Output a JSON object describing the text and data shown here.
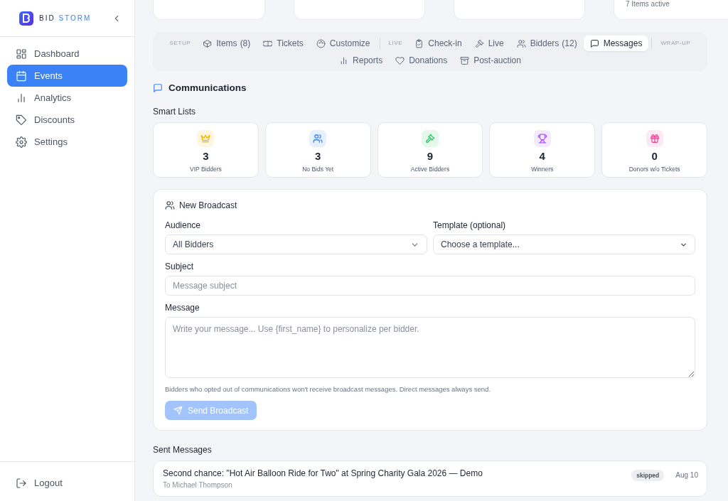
{
  "sidebar": {
    "logo": {
      "word_1": "BID",
      "word_2": "STORM"
    },
    "items": [
      {
        "label": "Dashboard",
        "selected": false
      },
      {
        "label": "Events",
        "selected": true
      },
      {
        "label": "Analytics",
        "selected": false
      },
      {
        "label": "Discounts",
        "selected": false
      },
      {
        "label": "Settings",
        "selected": false
      }
    ],
    "logout": "Logout"
  },
  "summary_caption": "7 Items active",
  "event_tabs": [
    {
      "label": "SETUP",
      "tabs": [
        {
          "label": "Items",
          "count": "(8)",
          "selected": false
        },
        {
          "label": "Tickets",
          "selected": false
        },
        {
          "label": "Customize",
          "selected": false
        }
      ]
    },
    {
      "label": "LIVE",
      "tabs": [
        {
          "label": "Check-in",
          "selected": false
        },
        {
          "label": "Live",
          "selected": false
        },
        {
          "label": "Bidders",
          "count": "(12)",
          "selected": false
        },
        {
          "label": "Messages",
          "selected": true
        }
      ]
    },
    {
      "label": "WRAP-UP",
      "tabs": [
        {
          "label": "Reports",
          "selected": false
        },
        {
          "label": "Donations",
          "selected": false
        },
        {
          "label": "Post-auction",
          "selected": false
        }
      ]
    }
  ],
  "section_title": "Communications",
  "smart_lists": {
    "title": "Smart Lists",
    "items": [
      {
        "kind": "crown",
        "color": "#f5b301",
        "count": "3",
        "label": "VIP Bidders"
      },
      {
        "kind": "users",
        "color": "#3b82f6",
        "count": "3",
        "label": "No Bids Yet"
      },
      {
        "kind": "gavel",
        "color": "#22c55e",
        "count": "9",
        "label": "Active Bidders"
      },
      {
        "kind": "trophy",
        "color": "#a855f7",
        "count": "4",
        "label": "Winners"
      },
      {
        "kind": "gift",
        "color": "#ec4899",
        "count": "0",
        "label": "Donors w/o Tickets"
      }
    ]
  },
  "broadcast": {
    "title": "New Broadcast",
    "audience": {
      "label": "Audience",
      "value": "All Bidders"
    },
    "template": {
      "label": "Template (optional)",
      "value": "Choose a template..."
    },
    "subject": {
      "label": "Subject",
      "placeholder": "Message subject"
    },
    "message": {
      "label": "Message",
      "placeholder": "Write your message... Use {first_name} to personalize per bidder."
    },
    "hint": "Bidders who opted out of communications won't receive broadcast messages. Direct messages always send.",
    "send_button": {
      "label": "Send Broadcast",
      "disabled": true
    }
  },
  "sent_messages": {
    "title": "Sent Messages",
    "items": [
      {
        "subject": "Second chance: \"Hot Air Balloon Ride for Two\" at Spring Charity Gala 2026 — Demo",
        "recipient": "To Michael Thompson",
        "status": "skipped",
        "date": "Aug 10"
      }
    ]
  }
}
